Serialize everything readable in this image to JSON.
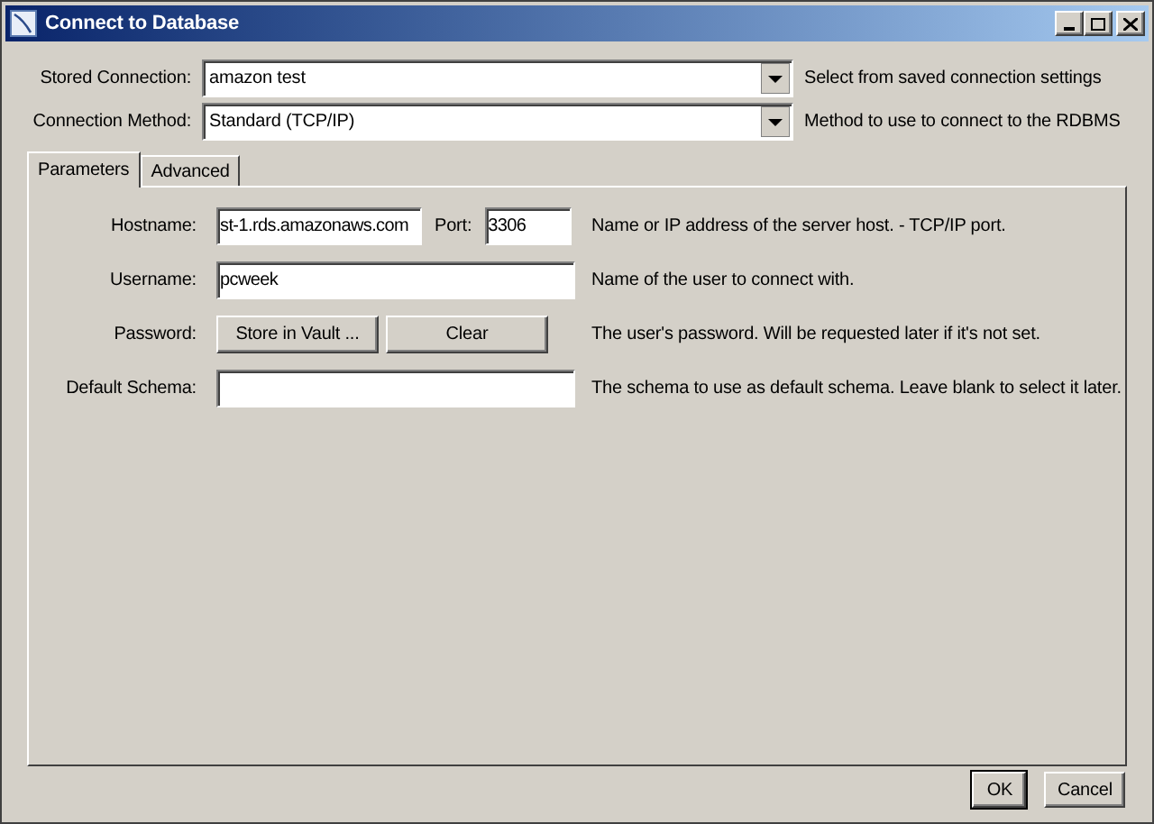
{
  "window": {
    "title": "Connect to Database"
  },
  "selectors": [
    {
      "label": "Stored Connection:",
      "value": "amazon test",
      "hint": "Select from saved connection settings"
    },
    {
      "label": "Connection Method:",
      "value": "Standard (TCP/IP)",
      "hint": "Method to use to connect to the RDBMS"
    }
  ],
  "tabs": [
    {
      "label": "Parameters",
      "selected": true
    },
    {
      "label": "Advanced",
      "selected": false
    }
  ],
  "rows": [
    {
      "kind": "host",
      "label": "Hostname:",
      "value": "st-1.rds.amazonaws.com",
      "port_label": "Port:",
      "port": "3306",
      "hint": "Name or IP address of the server host. - TCP/IP port."
    },
    {
      "kind": "text",
      "label": "Username:",
      "value": "pcweek",
      "hint": "Name of the user to connect with."
    },
    {
      "kind": "buttons",
      "label": "Password:",
      "buttons": [
        "Store in Vault ...",
        "Clear"
      ],
      "hint": "The user's password. Will be requested later if it's not set."
    },
    {
      "kind": "text",
      "label": "Default Schema:",
      "value": "",
      "hint": "The schema to use as default schema. Leave blank to select it later."
    }
  ],
  "footer_buttons": [
    {
      "label": "OK",
      "default": true
    },
    {
      "label": "Cancel",
      "default": false
    }
  ]
}
